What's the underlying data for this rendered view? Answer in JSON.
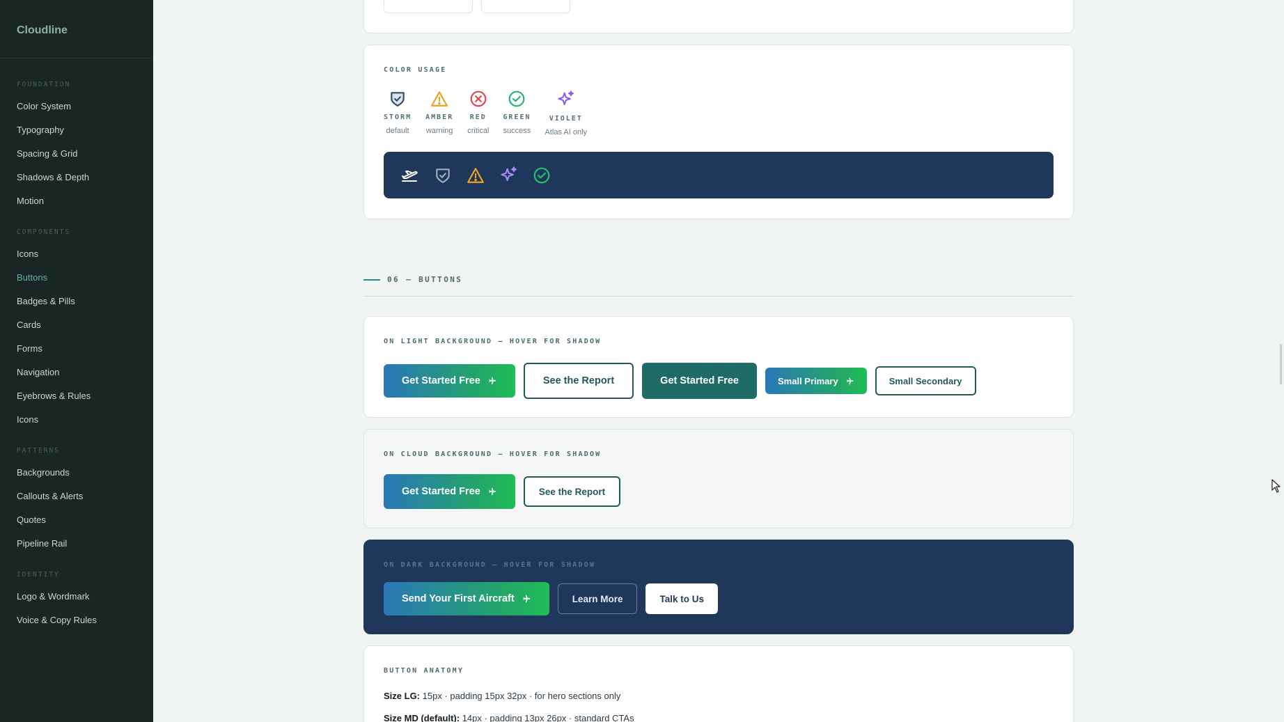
{
  "app": {
    "brand": "Cloudline"
  },
  "sidebar": {
    "groups": [
      {
        "label": "FOUNDATION",
        "items": [
          {
            "label": "Color System"
          },
          {
            "label": "Typography"
          },
          {
            "label": "Spacing & Grid"
          },
          {
            "label": "Shadows & Depth"
          },
          {
            "label": "Motion"
          }
        ]
      },
      {
        "label": "COMPONENTS",
        "items": [
          {
            "label": "Icons"
          },
          {
            "label": "Buttons",
            "active": true
          },
          {
            "label": "Badges & Pills"
          },
          {
            "label": "Cards"
          },
          {
            "label": "Forms"
          },
          {
            "label": "Navigation"
          },
          {
            "label": "Eyebrows & Rules"
          },
          {
            "label": "Icons"
          }
        ]
      },
      {
        "label": "PATTERNS",
        "items": [
          {
            "label": "Backgrounds"
          },
          {
            "label": "Callouts & Alerts"
          },
          {
            "label": "Quotes"
          },
          {
            "label": "Pipeline Rail"
          }
        ]
      },
      {
        "label": "IDENTITY",
        "items": [
          {
            "label": "Logo & Wordmark"
          },
          {
            "label": "Voice & Copy Rules"
          }
        ]
      }
    ]
  },
  "color_usage": {
    "title": "COLOR USAGE",
    "swatches": [
      {
        "name": "STORM",
        "desc": "default",
        "icon": "shield-check-icon",
        "color": "#2e4f6e"
      },
      {
        "name": "AMBER",
        "desc": "warning",
        "icon": "warning-triangle-icon",
        "color": "#e8a21f"
      },
      {
        "name": "RED",
        "desc": "critical",
        "icon": "x-circle-icon",
        "color": "#e0434b"
      },
      {
        "name": "GREEN",
        "desc": "success",
        "icon": "check-circle-icon",
        "color": "#23b56b"
      },
      {
        "name": "VIOLET",
        "desc": "Atlas AI only",
        "icon": "sparkle-icon",
        "color": "#8a5ce6"
      }
    ],
    "dark_strip_icons": [
      "plane-icon",
      "shield-check-icon",
      "warning-triangle-icon",
      "sparkle-icon",
      "check-circle-icon"
    ]
  },
  "section": {
    "label": "06 — BUTTONS"
  },
  "light_panel": {
    "eyebrow": "ON LIGHT BACKGROUND — HOVER FOR SHADOW",
    "primary_lg": "Get Started Free",
    "secondary_lg": "See the Report",
    "teal_lg": "Get Started Free",
    "primary_sm": "Small Primary",
    "secondary_sm": "Small Secondary"
  },
  "cloud_panel": {
    "eyebrow": "ON CLOUD BACKGROUND — HOVER FOR SHADOW",
    "primary": "Get Started Free",
    "secondary": "See the Report"
  },
  "dark_panel": {
    "eyebrow": "ON DARK BACKGROUND — HOVER FOR SHADOW",
    "primary": "Send Your First Aircraft",
    "outline": "Learn More",
    "white": "Talk to Us"
  },
  "anatomy": {
    "title": "BUTTON ANATOMY",
    "lines": [
      {
        "label": "Size LG:",
        "text": "15px · padding 15px 32px · for hero sections only"
      },
      {
        "label": "Size MD (default):",
        "text": "14px · padding 13px 26px · standard CTAs"
      }
    ]
  },
  "colors": {
    "sidebar_bg": "#1a2623",
    "accent_teal": "#2a8a7c",
    "navy": "#1e375a",
    "gradient_start": "#2a77b8",
    "gradient_end": "#1fbd57"
  }
}
